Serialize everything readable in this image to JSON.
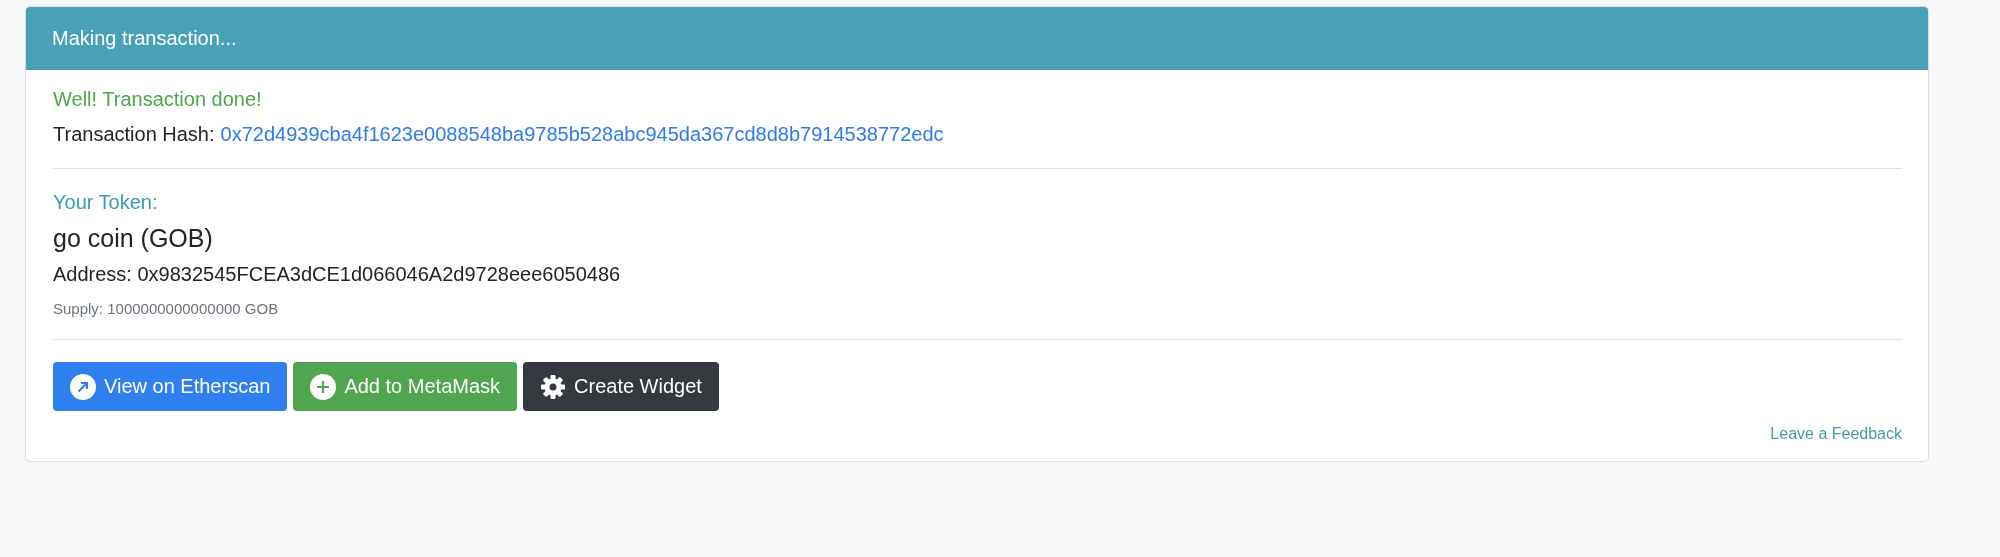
{
  "card": {
    "header": "Making transaction...",
    "status": "Well! Transaction done!",
    "hash_label": "Transaction Hash:",
    "hash": "0x72d4939cba4f1623e0088548ba9785b528abc945da367cd8d8b7914538772edc",
    "token_heading": "Your Token:",
    "token_name": "go coin (GOB)",
    "address": "Address: 0x9832545FCEA3dCE1d066046A2d9728eee6050486",
    "supply": "Supply: 1000000000000000 GOB",
    "buttons": [
      {
        "kind": "etherscan",
        "label": "View on Etherscan"
      },
      {
        "kind": "metamask",
        "label": "Add to MetaMask"
      },
      {
        "kind": "widget",
        "label": "Create Widget"
      }
    ],
    "feedback": "Leave a Feedback"
  }
}
